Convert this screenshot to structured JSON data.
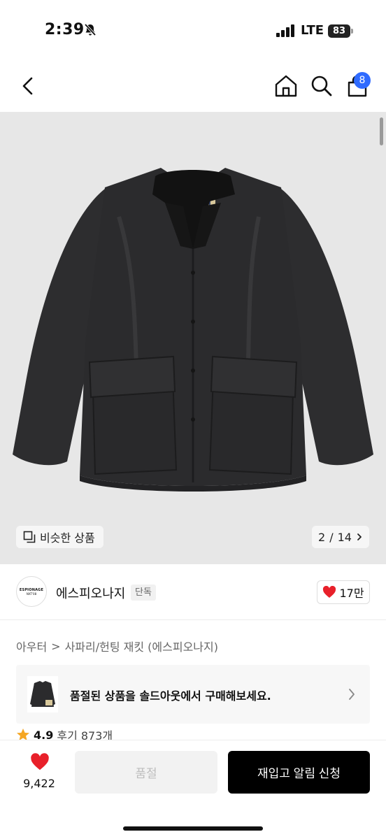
{
  "status_bar": {
    "time": "2:39",
    "network": "LTE",
    "battery": "83"
  },
  "nav": {
    "cart_count": "8"
  },
  "product_image": {
    "similar_label": "비슷한 상품",
    "current_page": "2",
    "total_pages": "14",
    "page_separator": "/"
  },
  "brand": {
    "logo_line1": "ESPIONAGE",
    "logo_line2": "NXT'08",
    "name": "에스피오나지",
    "badge": "단독",
    "likes": "17만"
  },
  "breadcrumb": {
    "category": "아우터",
    "separator": ">",
    "subcategory": "사파리/헌팅 재킷 (에스피오나지)"
  },
  "soldout_banner": {
    "text": "품절된 상품을 솔드아웃에서 구매해보세요."
  },
  "rating": {
    "score": "4.9",
    "reviews": "후기 873개"
  },
  "bottom_bar": {
    "like_count": "9,422",
    "soldout_label": "품절",
    "restock_label": "재입고 알림 신청"
  },
  "colors": {
    "accent_blue": "#2f6bff",
    "heart_red": "#e8202a",
    "star_orange": "#f5a623",
    "image_bg": "#e7e7e7"
  }
}
